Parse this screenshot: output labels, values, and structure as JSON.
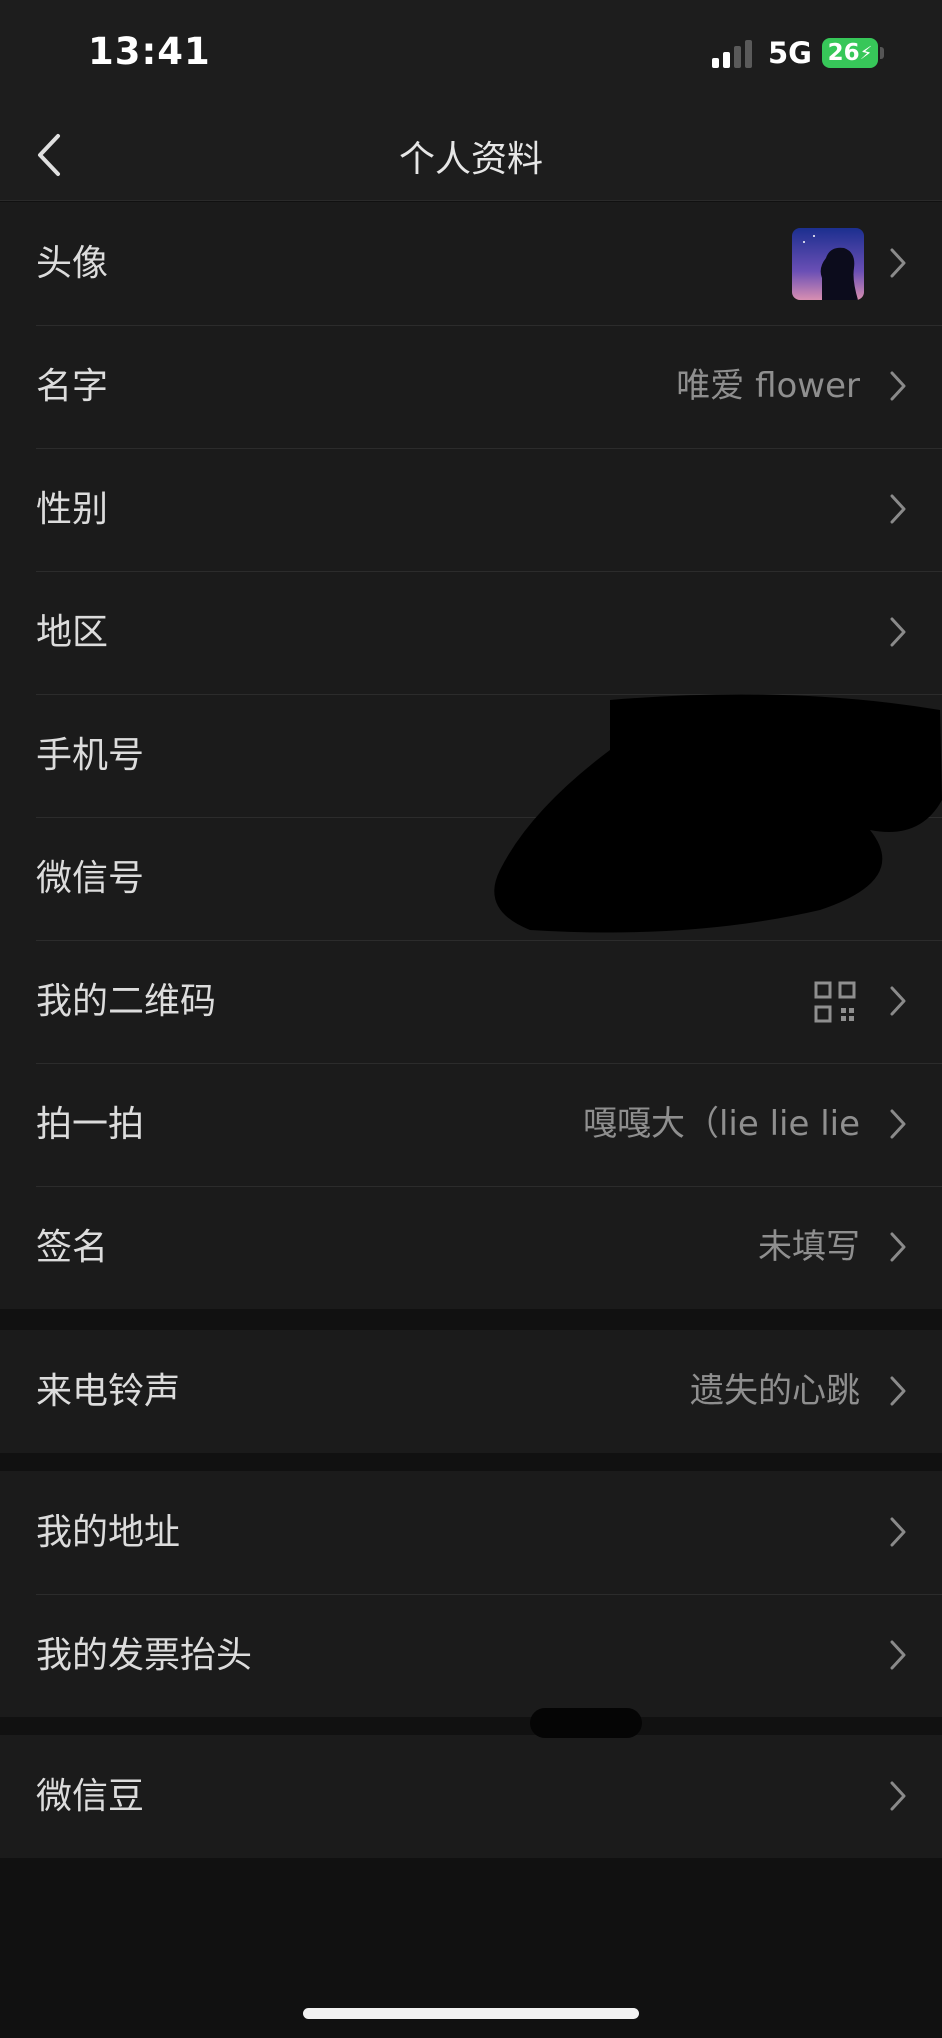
{
  "status_bar": {
    "time": "13:41",
    "network": "5G",
    "battery": "26"
  },
  "nav": {
    "title": "个人资料"
  },
  "groups": [
    {
      "rows": [
        {
          "label": "头像",
          "value": ""
        },
        {
          "label": "名字",
          "value": "唯爱 flower"
        },
        {
          "label": "性别",
          "value": ""
        },
        {
          "label": "地区",
          "value": ""
        },
        {
          "label": "手机号",
          "value": ""
        },
        {
          "label": "微信号",
          "value": ""
        },
        {
          "label": "我的二维码",
          "value": ""
        },
        {
          "label": "拍一拍",
          "value": "嘎嘎大（lie lie lie"
        },
        {
          "label": "签名",
          "value": "未填写"
        }
      ]
    },
    {
      "rows": [
        {
          "label": "来电铃声",
          "value": "遗失的心跳"
        }
      ]
    },
    {
      "rows": [
        {
          "label": "我的地址",
          "value": ""
        },
        {
          "label": "我的发票抬头",
          "value": ""
        }
      ]
    },
    {
      "rows": [
        {
          "label": "微信豆",
          "value": ""
        }
      ]
    }
  ],
  "icons": [
    "back-arrow-icon",
    "chevron-right-icon",
    "qr-code-icon",
    "signal-icon",
    "battery-icon"
  ],
  "colors": {
    "background": "#111111",
    "row_background": "#1b1b1b",
    "battery_green": "#37c759"
  }
}
